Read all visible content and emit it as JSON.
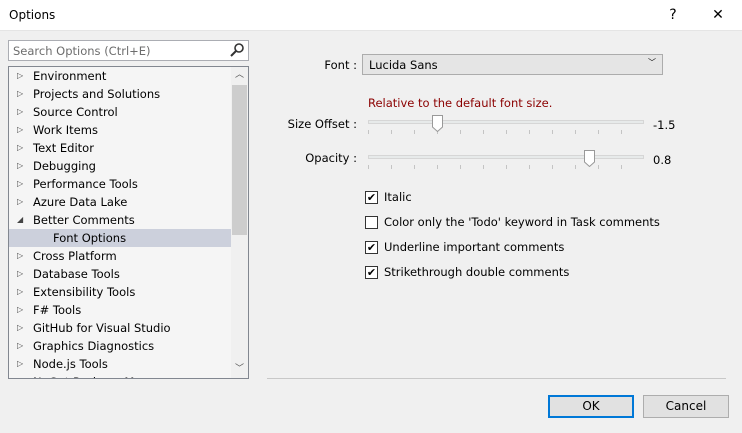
{
  "window": {
    "title": "Options",
    "help_label": "?",
    "close_label": "✕"
  },
  "search": {
    "placeholder": "Search Options (Ctrl+E)"
  },
  "tree": {
    "items": [
      {
        "label": "Environment",
        "state": "collapsed"
      },
      {
        "label": "Projects and Solutions",
        "state": "collapsed"
      },
      {
        "label": "Source Control",
        "state": "collapsed"
      },
      {
        "label": "Work Items",
        "state": "collapsed"
      },
      {
        "label": "Text Editor",
        "state": "collapsed"
      },
      {
        "label": "Debugging",
        "state": "collapsed"
      },
      {
        "label": "Performance Tools",
        "state": "collapsed"
      },
      {
        "label": "Azure Data Lake",
        "state": "collapsed"
      },
      {
        "label": "Better Comments",
        "state": "expanded"
      },
      {
        "label": "Font Options",
        "state": "child",
        "selected": true
      },
      {
        "label": "Cross Platform",
        "state": "collapsed"
      },
      {
        "label": "Database Tools",
        "state": "collapsed"
      },
      {
        "label": "Extensibility Tools",
        "state": "collapsed"
      },
      {
        "label": "F# Tools",
        "state": "collapsed"
      },
      {
        "label": "GitHub for Visual Studio",
        "state": "collapsed"
      },
      {
        "label": "Graphics Diagnostics",
        "state": "collapsed"
      },
      {
        "label": "Node.js Tools",
        "state": "collapsed"
      },
      {
        "label": "NuGet Package Manager",
        "state": "collapsed"
      }
    ]
  },
  "settings": {
    "font_label": "Font :",
    "font_value": "Lucida Sans",
    "hint": "Relative to the default font size.",
    "size_label": "Size Offset :",
    "size_value": "-1.5",
    "size_fraction": 0.25,
    "opacity_label": "Opacity :",
    "opacity_value": "0.8",
    "opacity_fraction": 0.8,
    "checkboxes": [
      {
        "label": "Italic",
        "checked": true
      },
      {
        "label": "Color only the 'Todo' keyword in Task comments",
        "checked": false
      },
      {
        "label": "Underline important comments",
        "checked": true
      },
      {
        "label": "Strikethrough double comments",
        "checked": true
      }
    ]
  },
  "buttons": {
    "ok": "OK",
    "cancel": "Cancel"
  }
}
